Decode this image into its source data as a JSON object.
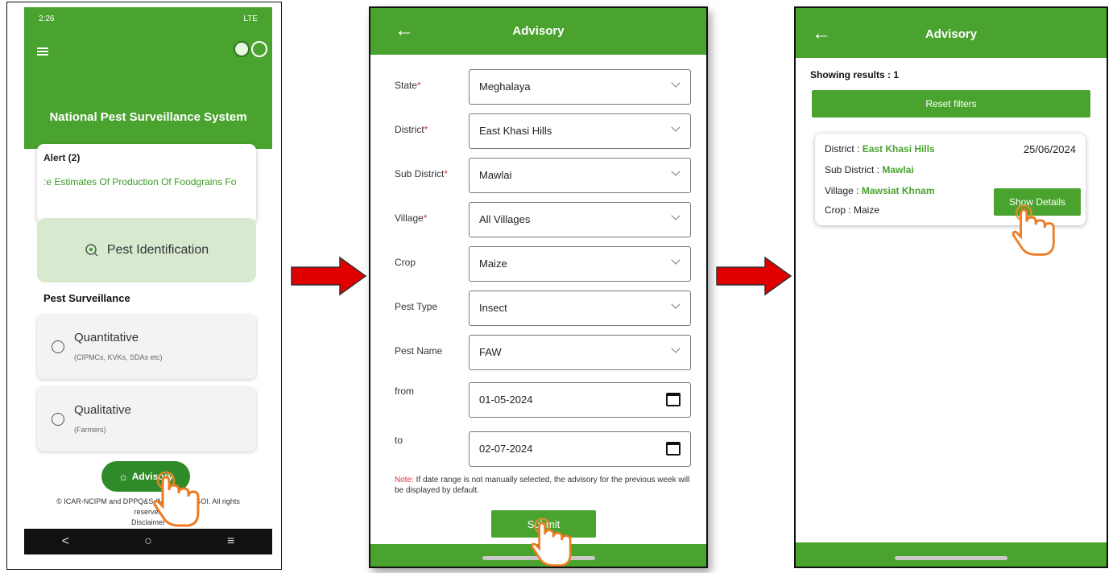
{
  "screen1": {
    "status_time": "2:26",
    "status_right": "LTE",
    "app_title": "National Pest Surveillance System",
    "alert_heading": "Alert (2)",
    "alert_ticker": ":e Estimates Of Production Of Foodgrains Fo",
    "pest_identification": "Pest Identification",
    "section_title": "Pest Surveillance",
    "quantitative_title": "Quantitative",
    "quantitative_sub": "(CIPMCs, KVKs, SDAs etc)",
    "qualitative_title": "Qualitative",
    "qualitative_sub": "(Farmers)",
    "advisory_button": "Advisory",
    "footer_line1": "© ICAR-NCIPM and DPPQ&S (MoA&FW), GOI. All rights",
    "footer_line2": "reserved",
    "footer_line3": "Disclaimer",
    "nav_back": "<",
    "nav_home": "○",
    "nav_recent": "≡"
  },
  "screen2": {
    "title": "Advisory",
    "fields": [
      {
        "label": "State",
        "required": "*",
        "value": "Meghalaya"
      },
      {
        "label": "District",
        "required": "*",
        "value": "East Khasi Hills"
      },
      {
        "label": "Sub District",
        "required": "*",
        "value": "Mawlai"
      },
      {
        "label": "Village",
        "required": "*",
        "value": "All Villages"
      },
      {
        "label": "Crop",
        "required": "",
        "value": "Maize"
      },
      {
        "label": "Pest Type",
        "required": "",
        "value": "Insect"
      },
      {
        "label": "Pest Name",
        "required": "",
        "value": "FAW"
      }
    ],
    "from_label": "from",
    "from_value": "01-05-2024",
    "to_label": "to",
    "to_value": "02-07-2024",
    "note_prefix": "Note:",
    "note_text": " If date range is not manually selected, the advisory for the previous week will be displayed by default.",
    "submit": "Submit"
  },
  "screen3": {
    "title": "Advisory",
    "results": "Showing results : 1",
    "reset": "Reset filters",
    "district_label": "District :",
    "district_value": "East Khasi Hills",
    "date": "25/06/2024",
    "subdistrict_label": "Sub District :",
    "subdistrict_value": "Mawlai",
    "village_label": "Village :",
    "village_value": "Mawsiat Khnam",
    "crop": "Crop : Maize",
    "show_details": "Show Details"
  },
  "colors": {
    "primary_green": "#4aa32f",
    "arrow_red": "#e00000",
    "required_red": "#dd3333"
  }
}
